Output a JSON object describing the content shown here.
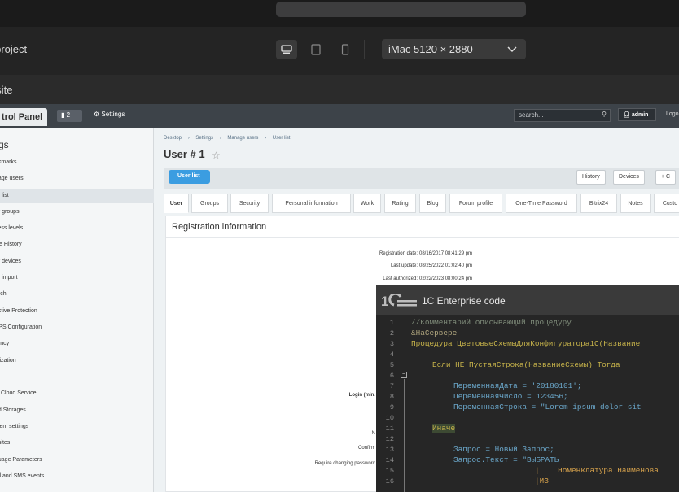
{
  "editor": {
    "project_name": "y project",
    "site_name": "osite",
    "device_select": "iMac  5120 × 2880",
    "icons": [
      "desktop-icon",
      "tablet-icon",
      "phone-icon",
      "chevron-down-icon"
    ]
  },
  "bitrix": {
    "control_panel_label": "trol Panel",
    "notif_count": "2",
    "settings_label": "Settings",
    "search_placeholder": "search...",
    "admin_label": "admin",
    "logout_label": "Logo",
    "sidebar": {
      "title": "gs",
      "items": [
        "okmarks",
        "nage users",
        "er list",
        "er groups",
        "cess levels",
        "file History",
        "er devices",
        "er import",
        "arch",
        "active Protection",
        "TPS Configuration",
        "rency",
        "alization",
        "",
        "ix Cloud Service",
        "ud Storages",
        "stem settings",
        "bsites",
        "guage Parameters",
        "ail and SMS events"
      ]
    },
    "breadcrumbs": [
      "Desktop",
      "›",
      "Settings",
      "›",
      "Manage users",
      "›",
      "User list"
    ],
    "page_title": "User # 1",
    "user_list_btn": "User list",
    "toolbar_buttons": [
      "History",
      "Devices",
      "+ C"
    ],
    "tabs": [
      "User",
      "Groups",
      "Security",
      "Personal information",
      "Work",
      "Rating",
      "Blog",
      "Forum profile",
      "One-Time Password",
      "Bitrix24",
      "Notes",
      "Custo"
    ],
    "section_title": "Registration information",
    "fields": [
      {
        "label": "Registration date:",
        "value": "08/16/2017 08:41:29 pm"
      },
      {
        "label": "Last update:",
        "value": "08/25/2022 01:02:40 pm"
      },
      {
        "label": "Last authorized:",
        "value": "02/22/2023 08:00:24 pm"
      }
    ],
    "partial_labels": [
      "Login (min.",
      "N",
      "Confirm",
      "Require changing password"
    ]
  },
  "code_window": {
    "title": "1C Enterprise code",
    "line_numbers": [
      "1",
      "2",
      "3",
      "4",
      "5",
      "6",
      "7",
      "8",
      "9",
      "10",
      "11",
      "12",
      "13",
      "14",
      "15",
      "16"
    ],
    "lines": [
      "//Комментарий описывающий процедуру",
      "&НаСервере",
      "Процедура ЦветовыеСхемыДляКонфигуратора1С(Название",
      "",
      "Если НЕ ПустаяСтрока(НазваниеСхемы) Тогда",
      "",
      "ПеременнаяДата = '20180101';",
      "ПеременнаяЧисло = 123456;",
      "ПеременнаяСтрока = \"Lorem ipsum dolor sit",
      "",
      "Иначе",
      "",
      "Запрос = Новый Запрос;",
      "Запрос.Текст = \"ВЫБРАТЬ",
      "|    Номенклатура.Наименова",
      "|ИЗ"
    ]
  }
}
